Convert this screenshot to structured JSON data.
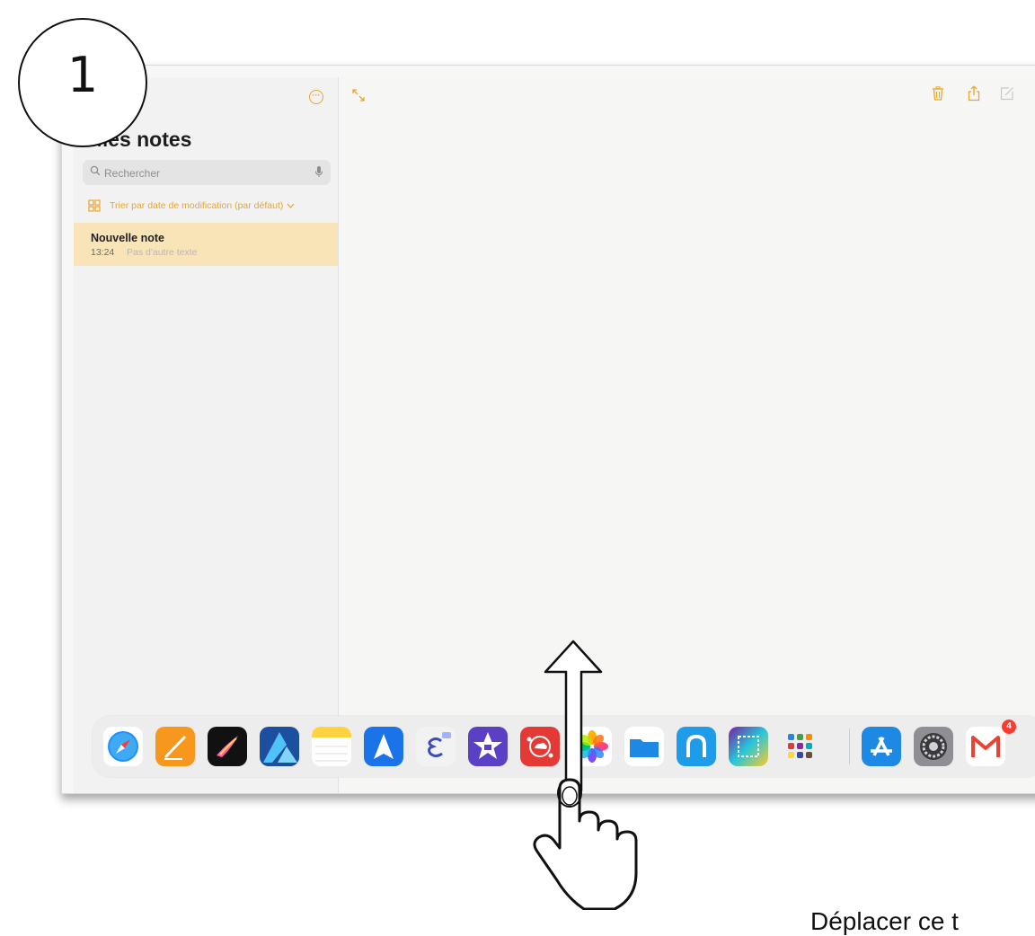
{
  "step": {
    "number": "1"
  },
  "sidebar": {
    "title": "Mes notes",
    "search": {
      "placeholder": "Rechercher"
    },
    "sort_label": "Trier par date de modification (par défaut)",
    "notes": [
      {
        "title": "Nouvelle note",
        "time": "13:24",
        "preview": "Pas d'autre texte"
      }
    ]
  },
  "dock": {
    "apps": [
      "safari-icon",
      "pages-icon",
      "procreate-icon",
      "affinity-designer-icon",
      "notes-icon",
      "spark-icon",
      "e-app-icon",
      "imovie-icon",
      "mindnode-icon",
      "photos-icon",
      "files-icon",
      "notability-icon",
      "book-creator-icon",
      "app-folder-icon",
      "app-store-icon",
      "settings-icon",
      "gmail-icon"
    ],
    "gmail_badge": "4"
  },
  "colors": {
    "accent": "#e7a72b",
    "note_highlight": "#f9e4b7"
  },
  "caption": "Déplacer ce t"
}
